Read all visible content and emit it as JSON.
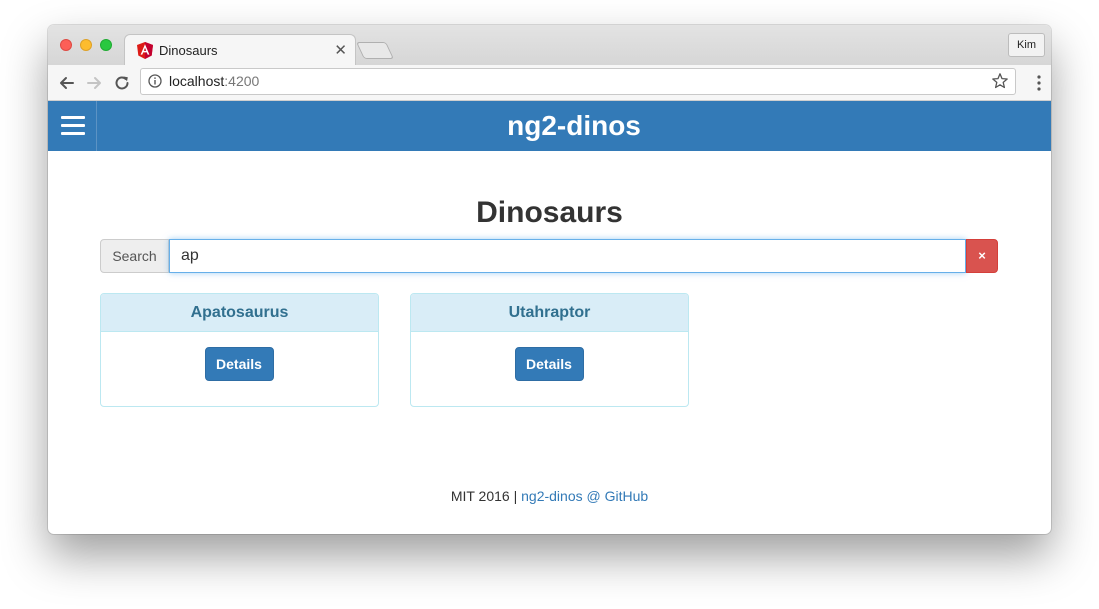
{
  "browser": {
    "tab_title": "Dinosaurs",
    "tab_close_icon": "close-icon",
    "profile_label": "Kim",
    "url_host": "localhost",
    "url_port": ":4200"
  },
  "app": {
    "brand": "ng2-dinos",
    "menu_icon": "hamburger-menu-icon",
    "accent_color": "#337ab7"
  },
  "main": {
    "title": "Dinosaurs",
    "search": {
      "addon_label": "Search",
      "value": "ap",
      "clear_label": "×"
    },
    "results": [
      {
        "name": "Apatosaurus",
        "button": "Details"
      },
      {
        "name": "Utahraptor",
        "button": "Details"
      }
    ]
  },
  "footer": {
    "text": "MIT 2016 | ",
    "link_text": "ng2-dinos @ GitHub"
  }
}
